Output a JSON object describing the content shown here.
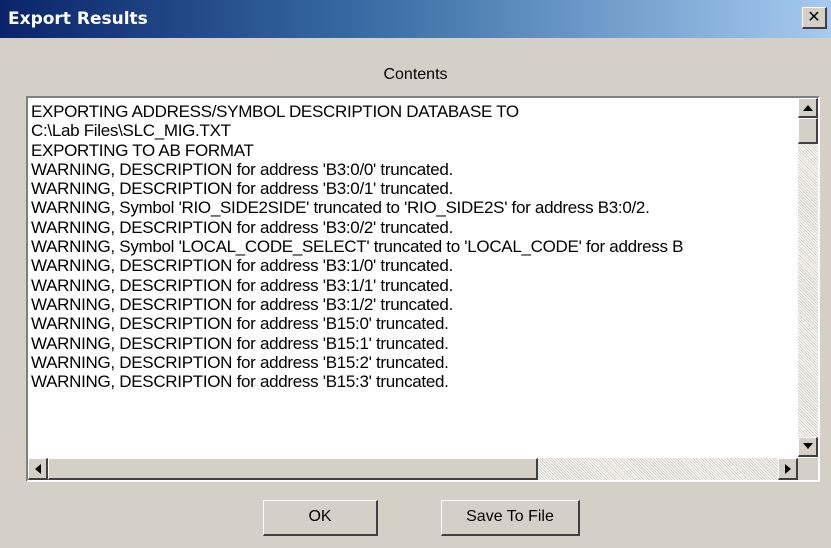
{
  "window": {
    "title": "Export Results",
    "close_glyph": "✕"
  },
  "contents_label": "Contents",
  "log_lines": [
    "EXPORTING ADDRESS/SYMBOL DESCRIPTION DATABASE TO",
    "C:\\Lab Files\\SLC_MIG.TXT",
    "EXPORTING TO AB FORMAT",
    "WARNING, DESCRIPTION for address 'B3:0/0' truncated.",
    "WARNING, DESCRIPTION for address 'B3:0/1' truncated.",
    "WARNING, Symbol 'RIO_SIDE2SIDE' truncated to 'RIO_SIDE2S' for address B3:0/2.",
    "WARNING, DESCRIPTION for address 'B3:0/2' truncated.",
    "WARNING, Symbol 'LOCAL_CODE_SELECT' truncated to 'LOCAL_CODE' for address B",
    "WARNING, DESCRIPTION for address 'B3:1/0' truncated.",
    "WARNING, DESCRIPTION for address 'B3:1/1' truncated.",
    "WARNING, DESCRIPTION for address 'B3:1/2' truncated.",
    "WARNING, DESCRIPTION for address 'B15:0' truncated.",
    "WARNING, DESCRIPTION for address 'B15:1' truncated.",
    "WARNING, DESCRIPTION for address 'B15:2' truncated.",
    "WARNING, DESCRIPTION for address 'B15:3' truncated."
  ],
  "buttons": {
    "ok_label": "OK",
    "save_label": "Save To File"
  },
  "colors": {
    "title_gradient_start": "#0a246a",
    "title_gradient_end": "#a6caf0",
    "face": "#d4d0c8"
  }
}
